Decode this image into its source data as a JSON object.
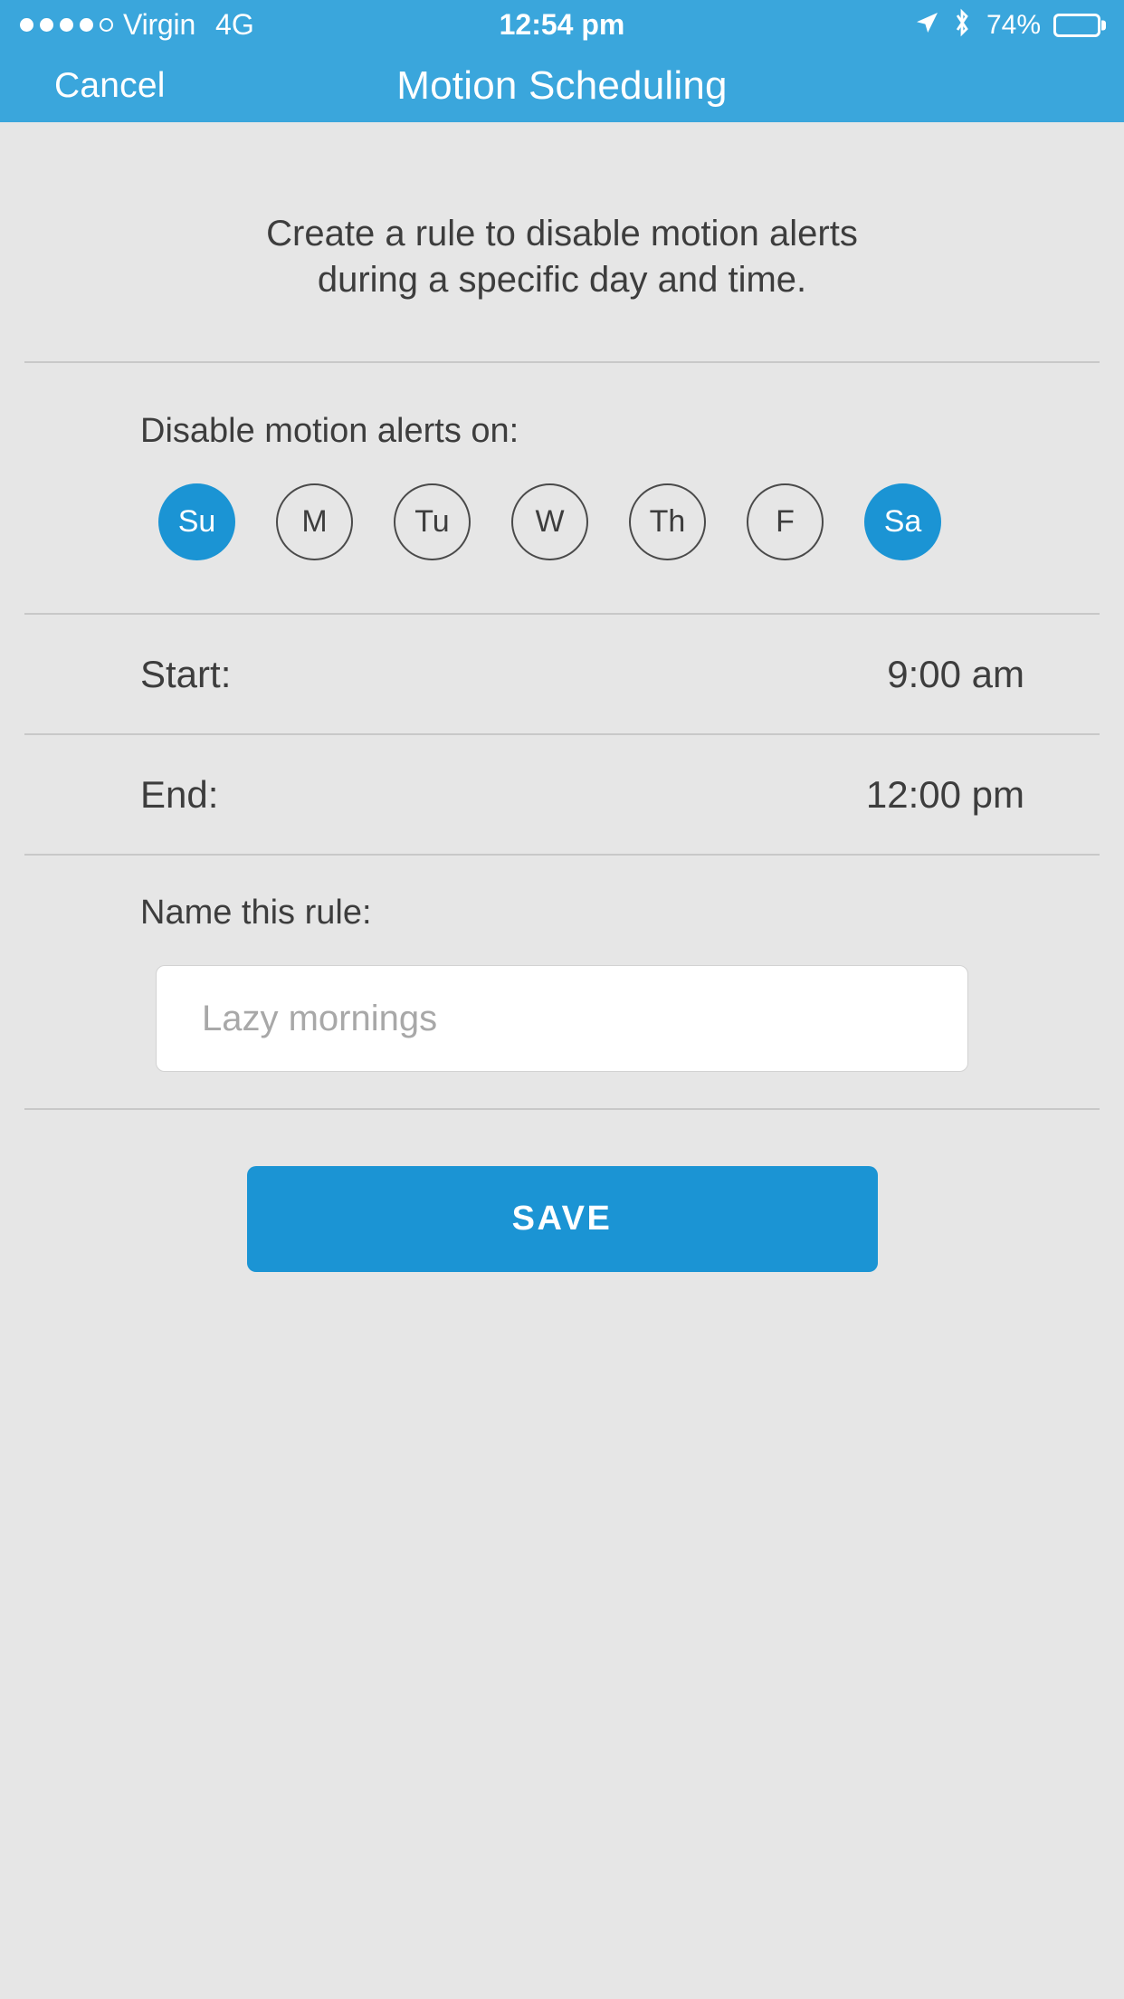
{
  "status_bar": {
    "carrier": "Virgin",
    "network": "4G",
    "time": "12:54 pm",
    "battery_percent": "74%",
    "signal_dots_filled": 4,
    "signal_dots_total": 5,
    "icons": {
      "location": "location-arrow-icon",
      "bluetooth": "bluetooth-icon",
      "battery": "battery-icon"
    }
  },
  "nav": {
    "cancel_label": "Cancel",
    "title": "Motion Scheduling"
  },
  "intro": {
    "line1": "Create a rule to disable motion alerts",
    "line2": "during a specific day and time."
  },
  "days": {
    "label": "Disable motion alerts on:",
    "items": [
      {
        "label": "Su",
        "selected": true
      },
      {
        "label": "M",
        "selected": false
      },
      {
        "label": "Tu",
        "selected": false
      },
      {
        "label": "W",
        "selected": false
      },
      {
        "label": "Th",
        "selected": false
      },
      {
        "label": "F",
        "selected": false
      },
      {
        "label": "Sa",
        "selected": true
      }
    ]
  },
  "start": {
    "label": "Start:",
    "value": "9:00 am"
  },
  "end": {
    "label": "End:",
    "value": "12:00 pm"
  },
  "rule_name": {
    "label": "Name this rule:",
    "placeholder": "Lazy mornings",
    "value": ""
  },
  "save": {
    "label": "SAVE"
  },
  "colors": {
    "header_blue": "#3aa6dc",
    "accent_blue": "#1b94d4",
    "background": "#e6e6e6",
    "text": "#3d3d3d",
    "divider": "#c8c8c8",
    "placeholder": "#a8a8a8"
  }
}
